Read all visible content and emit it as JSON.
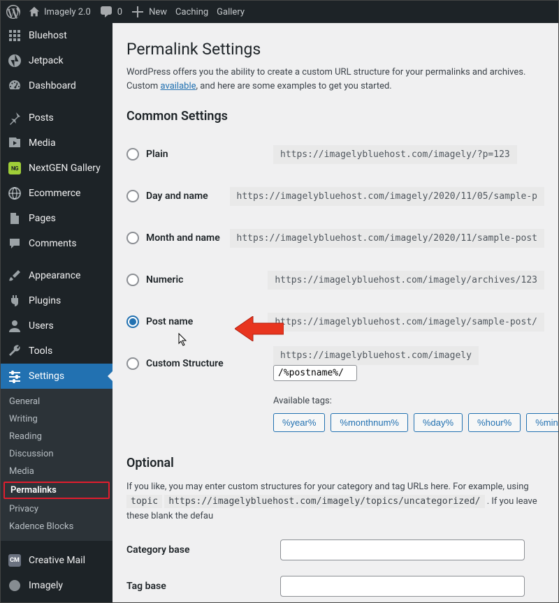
{
  "adminbar": {
    "site_title": "Imagely 2.0",
    "comments_count": "0",
    "new_label": "New",
    "items": [
      "Caching",
      "Gallery"
    ]
  },
  "sidebar": {
    "items": [
      {
        "label": "Bluehost",
        "icon": "dashboard-grid"
      },
      {
        "label": "Jetpack",
        "icon": "jetpack"
      },
      {
        "label": "Dashboard",
        "icon": "gauge"
      },
      {
        "label": "Posts",
        "icon": "pin"
      },
      {
        "label": "Media",
        "icon": "media"
      },
      {
        "label": "NextGEN Gallery",
        "icon": "nextgen"
      },
      {
        "label": "Ecommerce",
        "icon": "globe"
      },
      {
        "label": "Pages",
        "icon": "page"
      },
      {
        "label": "Comments",
        "icon": "comment"
      },
      {
        "label": "Appearance",
        "icon": "brush"
      },
      {
        "label": "Plugins",
        "icon": "plug"
      },
      {
        "label": "Users",
        "icon": "user"
      },
      {
        "label": "Tools",
        "icon": "wrench"
      },
      {
        "label": "Settings",
        "icon": "sliders"
      }
    ],
    "settings_sub": [
      "General",
      "Writing",
      "Reading",
      "Discussion",
      "Media",
      "Permalinks",
      "Privacy",
      "Kadence Blocks"
    ],
    "bottom": [
      {
        "label": "Creative Mail"
      },
      {
        "label": "Imagely"
      }
    ],
    "cm_badge": "CM"
  },
  "page": {
    "title": "Permalink Settings",
    "desc_pre": "WordPress offers you the ability to create a custom URL structure for your permalinks and archives. Custom ",
    "desc_link": "available",
    "desc_post": ", and here are some examples to get you started.",
    "common_heading": "Common Settings",
    "options": [
      {
        "label": "Plain",
        "url": "https://imagelybluehost.com/imagely/?p=123",
        "checked": false
      },
      {
        "label": "Day and name",
        "url": "https://imagelybluehost.com/imagely/2020/11/05/sample-p",
        "checked": false
      },
      {
        "label": "Month and name",
        "url": "https://imagelybluehost.com/imagely/2020/11/sample-post",
        "checked": false
      },
      {
        "label": "Numeric",
        "url": "https://imagelybluehost.com/imagely/archives/123",
        "checked": false
      },
      {
        "label": "Post name",
        "url": "https://imagelybluehost.com/imagely/sample-post/",
        "checked": true
      },
      {
        "label": "Custom Structure",
        "url": "https://imagelybluehost.com/imagely",
        "checked": false
      }
    ],
    "custom_value": "/%postname%/",
    "tags_label": "Available tags:",
    "tags": [
      "%year%",
      "%monthnum%",
      "%day%",
      "%hour%",
      "%minute%"
    ],
    "optional_heading": "Optional",
    "optional_desc_pre": "If you like, you may enter custom structures for your category and tag URLs here. For example, using ",
    "optional_code1": "topic",
    "optional_desc_mid": " ",
    "optional_code2": "https://imagelybluehost.com/imagely/topics/uncategorized/",
    "optional_desc_post": " . If you leave these blank the defau",
    "category_base_label": "Category base",
    "tag_base_label": "Tag base"
  }
}
